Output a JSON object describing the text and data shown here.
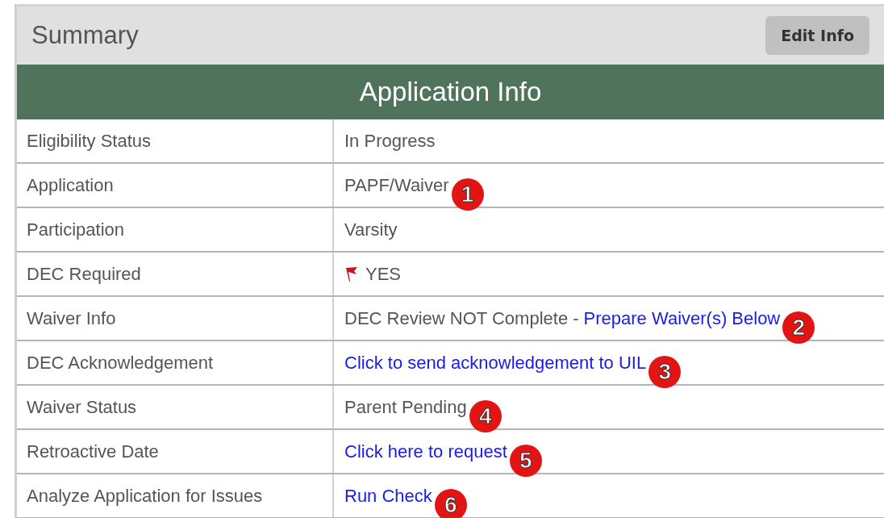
{
  "header": {
    "title": "Summary",
    "button": "Edit Info"
  },
  "section": {
    "title": "Application Info"
  },
  "rows": [
    {
      "label": "Eligibility Status",
      "parts": [
        {
          "text": "In Progress",
          "link": false
        }
      ]
    },
    {
      "label": "Application",
      "parts": [
        {
          "text": "PAPF/Waiver",
          "link": false
        }
      ],
      "badge": "1"
    },
    {
      "label": "Participation",
      "parts": [
        {
          "text": "Varsity",
          "link": false
        }
      ]
    },
    {
      "label": "DEC Required",
      "kind": "flag",
      "parts": [
        {
          "text": "YES",
          "link": false
        }
      ]
    },
    {
      "label": "Waiver Info",
      "parts": [
        {
          "text": "DEC Review NOT Complete -",
          "link": false
        },
        {
          "text": "Prepare Waiver(s) Below",
          "link": true
        }
      ],
      "badge": "2"
    },
    {
      "label": "DEC Acknowledgement",
      "parts": [
        {
          "text": "Click to send acknowledgement to UIL",
          "link": true
        }
      ],
      "badge": "3"
    },
    {
      "label": "Waiver Status",
      "parts": [
        {
          "text": "Parent Pending",
          "link": false
        }
      ],
      "badge": "4"
    },
    {
      "label": "Retroactive Date",
      "parts": [
        {
          "text": "Click here to request",
          "link": true
        }
      ],
      "badge": "5"
    },
    {
      "label": "Analyze Application for Issues",
      "parts": [
        {
          "text": "Run Check",
          "link": true
        }
      ],
      "badge": "6"
    }
  ]
}
